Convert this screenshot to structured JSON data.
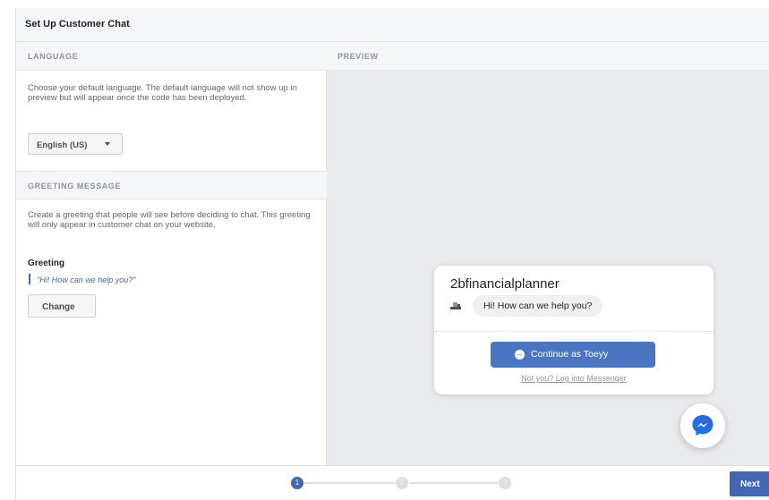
{
  "dialog": {
    "title": "Set Up Customer Chat"
  },
  "language": {
    "header": "LANGUAGE",
    "description": "Choose your default language. The default language will not show up in preview but will appear once the code has been deployed.",
    "selected": "English (US)"
  },
  "greeting": {
    "header": "GREETING MESSAGE",
    "description": "Create a greeting that people will see before deciding to chat. This greeting will only appear in customer chat on your website.",
    "label": "Greeting",
    "value": "\"Hi! How can we help you?\"",
    "change_label": "Change"
  },
  "preview": {
    "header": "PREVIEW",
    "page_name": "2bfinancialplanner",
    "bubble_text": "Hi! How can we help you?",
    "continue_label": "Continue as Toeyy",
    "login_link": "Not you? Log into Messenger",
    "fab_icon": "messenger-icon"
  },
  "footer": {
    "steps": [
      "1",
      "2",
      "3"
    ],
    "active_step": 1,
    "next_label": "Next"
  },
  "colors": {
    "accent": "#4267b2",
    "continue_button": "#4a76c1",
    "preview_background": "#e9eaed"
  }
}
